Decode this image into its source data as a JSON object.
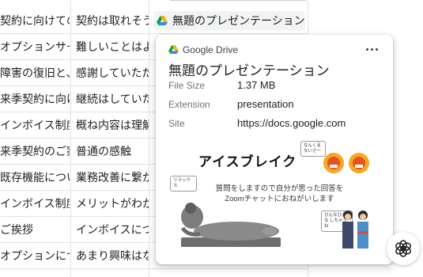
{
  "sheet": {
    "rows": [
      {
        "c1": "契約に向けての",
        "c2": "契約は取れそう"
      },
      {
        "c1": "オプションサー",
        "c2": "難しいことはよ"
      },
      {
        "c1": "障害の復旧と、",
        "c2": "感謝していただ"
      },
      {
        "c1": "来季契約に向け",
        "c2": "継続はしていた"
      },
      {
        "c1": "インボイス制度",
        "c2": "概ね内容は理解"
      },
      {
        "c1": "来季契約のご案",
        "c2": "普通の感触"
      },
      {
        "c1": "既存機能につい",
        "c2": "業務改善に繋が"
      },
      {
        "c1": "インボイス制度",
        "c2": "メリットがわか"
      },
      {
        "c1": "ご挨拶",
        "c2": "インボイスにつ"
      },
      {
        "c1": "オプションにつ",
        "c2": "あまり興味はな"
      }
    ],
    "chip_label": "無題のプレゼンテーション"
  },
  "card": {
    "source": "Google Drive",
    "title": "無題のプレゼンテーション",
    "meta": [
      {
        "label": "File Size",
        "value": "1.37 MB"
      },
      {
        "label": "Extension",
        "value": "presentation"
      },
      {
        "label": "Site",
        "value": "https://docs.google.com"
      }
    ],
    "preview": {
      "title": "アイスブレイク",
      "text": "質問をしますので自分が思った回答を Zoomチャットにおねがいします",
      "bubble_left": "リラックス",
      "bubble_top": "なんくる ないさー",
      "bubble_right": "ひんなひんな しちゃうね"
    }
  },
  "colors": {
    "drive_green": "#0f9d58",
    "drive_yellow": "#f4b400",
    "drive_blue": "#4285f4",
    "grid_line": "#e2e2e2"
  },
  "icons": [
    "google-drive-icon",
    "more-vert-icon",
    "chatgpt-icon"
  ]
}
